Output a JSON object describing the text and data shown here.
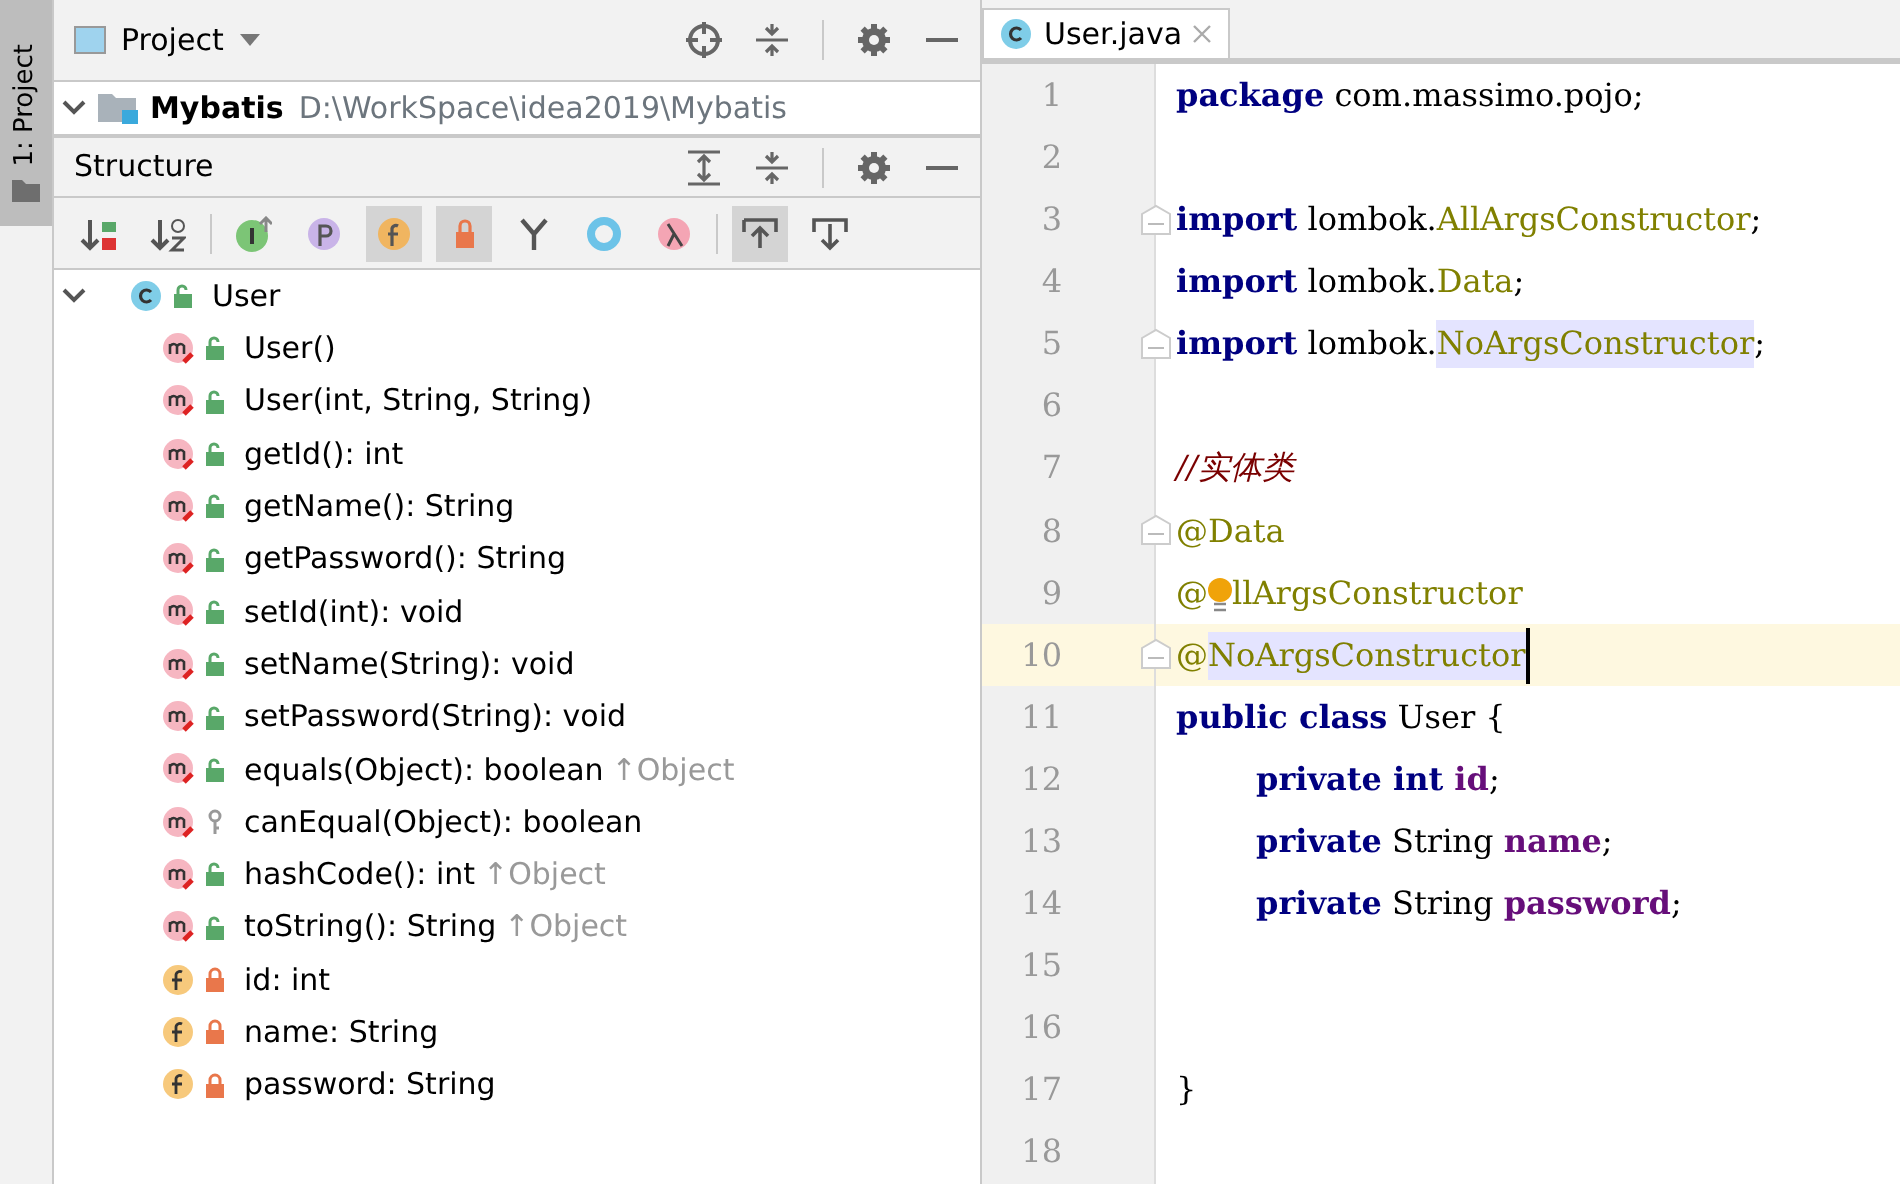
{
  "side_stripe": {
    "tab": "1: Project",
    "selected": true
  },
  "project_panel": {
    "title": "Project",
    "root": {
      "name": "Mybatis",
      "path": "D:\\WorkSpace\\idea2019\\Mybatis",
      "expanded": true
    }
  },
  "structure_panel": {
    "title": "Structure",
    "toolbar": [
      {
        "kind": "sort-visibility",
        "selected": false
      },
      {
        "kind": "sort-alpha",
        "selected": false
      },
      {
        "kind": "sep"
      },
      {
        "kind": "inherited",
        "selected": false
      },
      {
        "kind": "properties",
        "selected": false
      },
      {
        "kind": "fields",
        "selected": true
      },
      {
        "kind": "non-public",
        "selected": true
      },
      {
        "kind": "fork",
        "selected": false
      },
      {
        "kind": "anonymous",
        "selected": false
      },
      {
        "kind": "lambdas",
        "selected": false
      },
      {
        "kind": "sep"
      },
      {
        "kind": "autoscroll-to",
        "selected": true
      },
      {
        "kind": "autoscroll-from",
        "selected": false
      }
    ],
    "tree": [
      {
        "kind": "public-class",
        "label": "User",
        "expanded": true,
        "children": [
          {
            "kind": "public-method",
            "label": "User()"
          },
          {
            "kind": "public-method",
            "label": "User(int, String, String)"
          },
          {
            "kind": "public-method",
            "label": "getId(): int"
          },
          {
            "kind": "public-method",
            "label": "getName(): String"
          },
          {
            "kind": "public-method",
            "label": "getPassword(): String"
          },
          {
            "kind": "public-method",
            "label": "setId(int): void"
          },
          {
            "kind": "public-method",
            "label": "setName(String): void"
          },
          {
            "kind": "public-method",
            "label": "setPassword(String): void"
          },
          {
            "kind": "public-method",
            "label": "equals(Object): boolean",
            "inherited": "↑Object"
          },
          {
            "kind": "protected-method",
            "label": "canEqual(Object): boolean"
          },
          {
            "kind": "public-method",
            "label": "hashCode(): int",
            "inherited": "↑Object"
          },
          {
            "kind": "public-method",
            "label": "toString(): String",
            "inherited": "↑Object"
          },
          {
            "kind": "private-field",
            "label": "id: int"
          },
          {
            "kind": "private-field",
            "label": "name: String"
          },
          {
            "kind": "private-field",
            "label": "password: String"
          }
        ]
      }
    ]
  },
  "editor": {
    "tabs": [
      {
        "label": "User.java",
        "selected": true
      }
    ],
    "lines": [
      {
        "number": "1",
        "tokens": [
          {
            "kind": "keyword",
            "text": "package"
          },
          {
            "kind": "plain",
            "text": " com.massimo.pojo;"
          }
        ]
      },
      {
        "number": "2"
      },
      {
        "number": "3",
        "fold": true,
        "tokens": [
          {
            "kind": "keyword",
            "text": "import"
          },
          {
            "kind": "plain",
            "text": " lombok."
          },
          {
            "kind": "annotation",
            "text": "AllArgsConstructor"
          },
          {
            "kind": "plain",
            "text": ";"
          }
        ]
      },
      {
        "number": "4",
        "tokens": [
          {
            "kind": "keyword",
            "text": "import"
          },
          {
            "kind": "plain",
            "text": " lombok."
          },
          {
            "kind": "annotation",
            "text": "Data"
          },
          {
            "kind": "plain",
            "text": ";"
          }
        ]
      },
      {
        "number": "5",
        "fold": true,
        "tokens": [
          {
            "kind": "keyword",
            "text": "import"
          },
          {
            "kind": "plain",
            "text": " lombok."
          },
          {
            "kind": "annotation",
            "text": "NoArgsConstructor",
            "highlight": true
          },
          {
            "kind": "plain",
            "text": ";"
          }
        ]
      },
      {
        "number": "6"
      },
      {
        "number": "7",
        "tokens": [
          {
            "kind": "comment",
            "text": "//实体类"
          }
        ]
      },
      {
        "number": "8",
        "fold": true,
        "tokens": [
          {
            "kind": "annotation",
            "text": "@Data"
          }
        ]
      },
      {
        "number": "9",
        "tokens": [
          {
            "kind": "annotation",
            "text": "@"
          },
          {
            "kind": "bulb"
          },
          {
            "kind": "annotation",
            "text": "llArgsConstructor"
          }
        ]
      },
      {
        "number": "10",
        "fold": true,
        "current": true,
        "tokens": [
          {
            "kind": "annotation",
            "text": "@"
          },
          {
            "kind": "annotation",
            "text": "NoArgsConstructor",
            "highlight": true
          },
          {
            "kind": "caret"
          }
        ]
      },
      {
        "number": "11",
        "tokens": [
          {
            "kind": "keyword",
            "text": "public class"
          },
          {
            "kind": "plain",
            "text": " User {"
          }
        ]
      },
      {
        "number": "12",
        "indent": true,
        "tokens": [
          {
            "kind": "keyword",
            "text": "private int "
          },
          {
            "kind": "field",
            "text": "id"
          },
          {
            "kind": "plain",
            "text": ";"
          }
        ]
      },
      {
        "number": "13",
        "indent": true,
        "tokens": [
          {
            "kind": "keyword",
            "text": "private"
          },
          {
            "kind": "plain",
            "text": " String "
          },
          {
            "kind": "field",
            "text": "name"
          },
          {
            "kind": "plain",
            "text": ";"
          }
        ]
      },
      {
        "number": "14",
        "indent": true,
        "tokens": [
          {
            "kind": "keyword",
            "text": "private"
          },
          {
            "kind": "plain",
            "text": " String "
          },
          {
            "kind": "field",
            "text": "password"
          },
          {
            "kind": "plain",
            "text": ";"
          }
        ]
      },
      {
        "number": "15"
      },
      {
        "number": "16"
      },
      {
        "number": "17",
        "tokens": [
          {
            "kind": "plain",
            "text": "}"
          }
        ]
      },
      {
        "number": "18"
      }
    ]
  }
}
